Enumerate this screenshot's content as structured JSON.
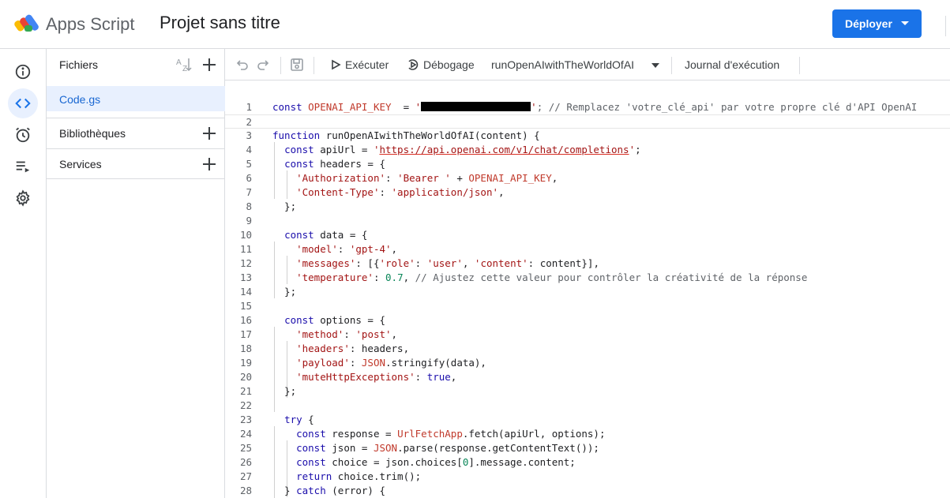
{
  "header": {
    "app_name": "Apps Script",
    "project_title": "Projet sans titre",
    "deploy_label": "Déployer"
  },
  "rail": {
    "items": [
      "info-icon",
      "code-icon",
      "alarm-icon",
      "executions-icon",
      "settings-icon"
    ],
    "active": "code-icon"
  },
  "files_panel": {
    "title": "Fichiers",
    "files": [
      "Code.gs"
    ],
    "sections": [
      "Bibliothèques",
      "Services"
    ]
  },
  "toolbar": {
    "run_label": "Exécuter",
    "debug_label": "Débogage",
    "function_name": "runOpenAIwithTheWorldOfAI",
    "log_label": "Journal d'exécution"
  },
  "editor": {
    "current_line": 2,
    "lines": [
      [
        [
          "kw",
          "const "
        ],
        [
          "glb",
          "OPENAI_API_KEY"
        ],
        [
          "",
          "  = "
        ],
        [
          "str",
          "'"
        ],
        [
          "redact",
          ""
        ],
        [
          "str",
          "'"
        ],
        [
          "cm",
          "; // Remplacez 'votre_clé_api' par votre propre clé d'API OpenAI"
        ]
      ],
      [],
      [
        [
          "kw",
          "function "
        ],
        [
          "",
          "runOpenAIwithTheWorldOfAI(content) {"
        ]
      ],
      [
        [
          "",
          "  "
        ],
        [
          "kw",
          "const "
        ],
        [
          "",
          "apiUrl = "
        ],
        [
          "str",
          "'"
        ],
        [
          "url",
          "https://api.openai.com/v1/chat/completions"
        ],
        [
          "str",
          "'"
        ],
        [
          "",
          ";"
        ]
      ],
      [
        [
          "",
          "  "
        ],
        [
          "kw",
          "const "
        ],
        [
          "",
          "headers = {"
        ]
      ],
      [
        [
          "",
          "    "
        ],
        [
          "prop",
          "'Authorization'"
        ],
        [
          "",
          ": "
        ],
        [
          "str",
          "'Bearer '"
        ],
        [
          "",
          " + "
        ],
        [
          "glb",
          "OPENAI_API_KEY"
        ],
        [
          "",
          ","
        ]
      ],
      [
        [
          "",
          "    "
        ],
        [
          "prop",
          "'Content-Type'"
        ],
        [
          "",
          ": "
        ],
        [
          "str",
          "'application/json'"
        ],
        [
          "",
          ","
        ]
      ],
      [
        [
          "",
          "  };"
        ]
      ],
      [],
      [
        [
          "",
          "  "
        ],
        [
          "kw",
          "const "
        ],
        [
          "",
          "data = {"
        ]
      ],
      [
        [
          "",
          "    "
        ],
        [
          "prop",
          "'model'"
        ],
        [
          "",
          ": "
        ],
        [
          "str",
          "'gpt-4'"
        ],
        [
          "",
          ","
        ]
      ],
      [
        [
          "",
          "    "
        ],
        [
          "prop",
          "'messages'"
        ],
        [
          "",
          ": [{"
        ],
        [
          "prop",
          "'role'"
        ],
        [
          "",
          ": "
        ],
        [
          "str",
          "'user'"
        ],
        [
          "",
          ", "
        ],
        [
          "prop",
          "'content'"
        ],
        [
          "",
          ": content}],"
        ]
      ],
      [
        [
          "",
          "    "
        ],
        [
          "prop",
          "'temperature'"
        ],
        [
          "",
          ": "
        ],
        [
          "num",
          "0.7"
        ],
        [
          "",
          ", "
        ],
        [
          "cm",
          "// Ajustez cette valeur pour contrôler la créativité de la réponse"
        ]
      ],
      [
        [
          "",
          "  };"
        ]
      ],
      [],
      [
        [
          "",
          "  "
        ],
        [
          "kw",
          "const "
        ],
        [
          "",
          "options = {"
        ]
      ],
      [
        [
          "",
          "    "
        ],
        [
          "prop",
          "'method'"
        ],
        [
          "",
          ": "
        ],
        [
          "str",
          "'post'"
        ],
        [
          "",
          ","
        ]
      ],
      [
        [
          "",
          "    "
        ],
        [
          "prop",
          "'headers'"
        ],
        [
          "",
          ": headers,"
        ]
      ],
      [
        [
          "",
          "    "
        ],
        [
          "prop",
          "'payload'"
        ],
        [
          "",
          ": "
        ],
        [
          "glb",
          "JSON"
        ],
        [
          "",
          ".stringify(data),"
        ]
      ],
      [
        [
          "",
          "    "
        ],
        [
          "prop",
          "'muteHttpExceptions'"
        ],
        [
          "",
          ": "
        ],
        [
          "kw",
          "true"
        ],
        [
          "",
          ","
        ]
      ],
      [
        [
          "",
          "  };"
        ]
      ],
      [],
      [
        [
          "",
          "  "
        ],
        [
          "kw",
          "try"
        ],
        [
          "",
          " {"
        ]
      ],
      [
        [
          "",
          "    "
        ],
        [
          "kw",
          "const "
        ],
        [
          "",
          "response = "
        ],
        [
          "glb",
          "UrlFetchApp"
        ],
        [
          "",
          ".fetch(apiUrl, options);"
        ]
      ],
      [
        [
          "",
          "    "
        ],
        [
          "kw",
          "const "
        ],
        [
          "",
          "json = "
        ],
        [
          "glb",
          "JSON"
        ],
        [
          "",
          ".parse(response.getContentText());"
        ]
      ],
      [
        [
          "",
          "    "
        ],
        [
          "kw",
          "const "
        ],
        [
          "",
          "choice = json.choices["
        ],
        [
          "num",
          "0"
        ],
        [
          "",
          "].message.content;"
        ]
      ],
      [
        [
          "",
          "    "
        ],
        [
          "kw",
          "return "
        ],
        [
          "",
          "choice.trim();"
        ]
      ],
      [
        [
          "",
          "  } "
        ],
        [
          "kw",
          "catch"
        ],
        [
          "",
          " (error) {"
        ]
      ]
    ]
  }
}
